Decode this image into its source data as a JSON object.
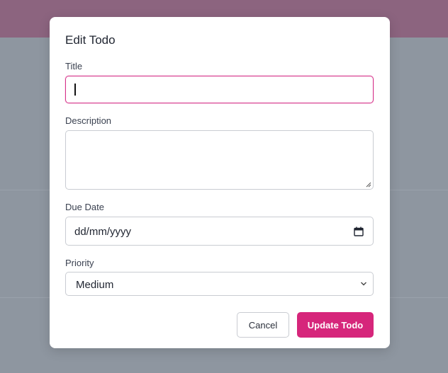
{
  "modal": {
    "title": "Edit Todo",
    "fields": {
      "title": {
        "label": "Title",
        "value": ""
      },
      "description": {
        "label": "Description",
        "value": ""
      },
      "due_date": {
        "label": "Due Date",
        "value": "dd/mm/yyyy"
      },
      "priority": {
        "label": "Priority",
        "value": "Medium"
      }
    },
    "buttons": {
      "cancel": "Cancel",
      "update": "Update Todo"
    }
  },
  "colors": {
    "accent": "#d6267b",
    "focus_border": "#d6338a",
    "header": "#8c647f",
    "overlay": "#8e96a0"
  },
  "icons": {
    "date": "calendar-icon",
    "select": "chevron-down-icon",
    "textarea": "resize-grip-icon"
  }
}
